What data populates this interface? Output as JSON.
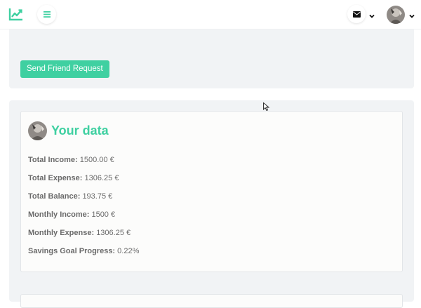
{
  "header": {
    "logo_icon": "chart-line-icon",
    "menu_icon": "hamburger-icon",
    "mail_icon": "envelope-icon",
    "accent": "#3fd0a1"
  },
  "friend": {
    "button_label": "Send Friend Request"
  },
  "data_card": {
    "title": "Your data",
    "stats": [
      {
        "label": "Total Income:",
        "value": "1500.00 €"
      },
      {
        "label": "Total Expense:",
        "value": "1306.25 €"
      },
      {
        "label": "Total Balance:",
        "value": "193.75 €"
      },
      {
        "label": "Monthly Income:",
        "value": "1500 €"
      },
      {
        "label": "Monthly Expense:",
        "value": "1306.25 €"
      },
      {
        "label": "Savings Goal Progress:",
        "value": "0.22%"
      }
    ]
  }
}
